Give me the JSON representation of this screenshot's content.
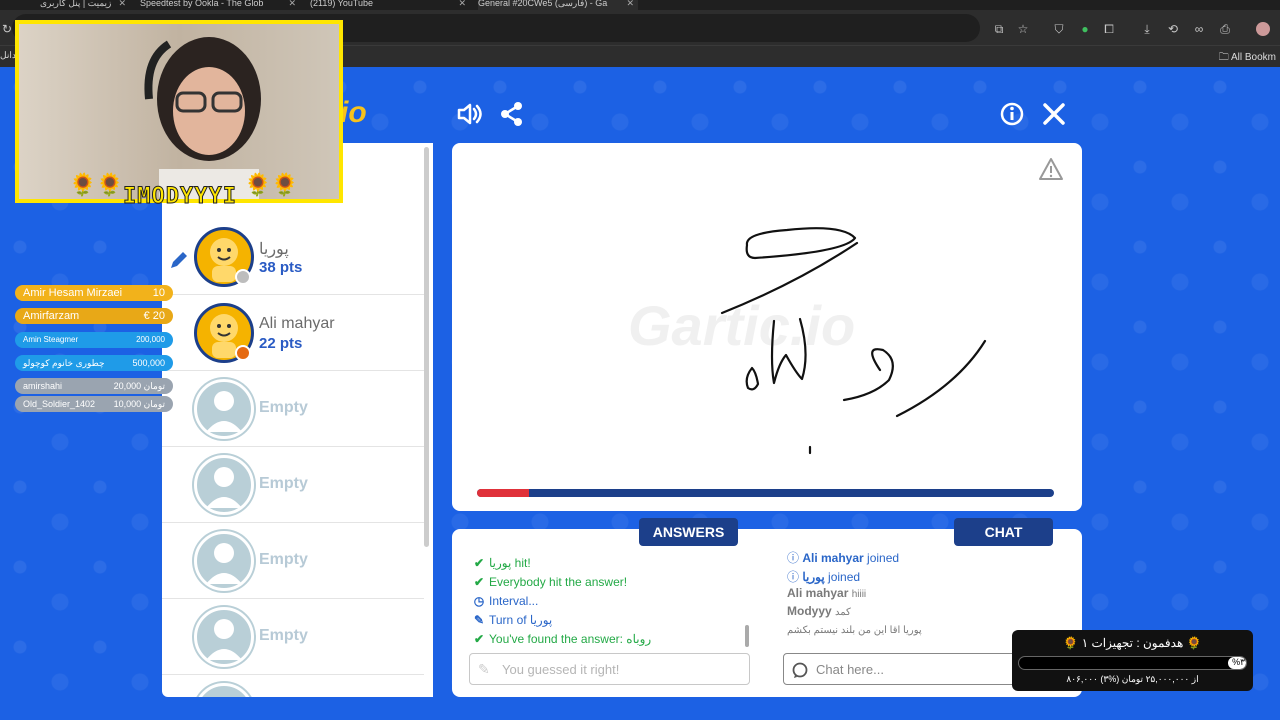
{
  "browser": {
    "tabs": [
      {
        "label": "زیمیت | پنل کاربری"
      },
      {
        "label": "Speedtest by Ookla - The Glob"
      },
      {
        "label": "(2119) YouTube"
      },
      {
        "label": "General #20CWe5 (فارسی) - Ga",
        "active": true
      }
    ],
    "bookmarks_all": "All Bookm",
    "bookmarks_left": "دانل"
  },
  "game": {
    "logo_fragment": "io",
    "canvas_watermark": "Gartic.io",
    "timer_fraction": 0.09,
    "players": [
      {
        "name": "پوریا",
        "points": "38 pts",
        "drawing": true,
        "status_color": "#bdbdbd"
      },
      {
        "name": "Ali mahyar",
        "points": "22 pts",
        "drawing": false,
        "status_color": "#e56a12"
      },
      {
        "name": "Empty"
      },
      {
        "name": "Empty"
      },
      {
        "name": "Empty"
      },
      {
        "name": "Empty"
      }
    ],
    "answers_tab": "ANSWERS",
    "chat_tab": "CHAT",
    "answers": [
      {
        "icon": "check",
        "text": "پوریا hit!",
        "color": "green"
      },
      {
        "icon": "check",
        "text": "Everybody hit the answer!",
        "color": "green"
      },
      {
        "icon": "clock",
        "text": "Interval...",
        "color": "blue"
      },
      {
        "icon": "pencil",
        "text": "Turn of پوریا",
        "color": "blue"
      },
      {
        "icon": "check",
        "text": "You've found the answer: روباه",
        "color": "green"
      }
    ],
    "answer_placeholder": "You guessed it right!",
    "chat": [
      {
        "icon": "info",
        "user": "Ali mahyar",
        "text": "joined"
      },
      {
        "icon": "info",
        "user": "پوریا",
        "text": "joined"
      },
      {
        "user": "Ali mahyar",
        "text": "hiiii"
      },
      {
        "user": "Modyyy",
        "text": "کمد"
      },
      {
        "user": "",
        "text": "پوریا اقا این من بلند نیستم بکشم"
      }
    ],
    "chat_placeholder": "Chat here..."
  },
  "stream": {
    "streamer_name": "IMODYYYI",
    "donations": [
      {
        "name": "Amir Hesam Mirzaei",
        "amount": "10",
        "color": "#f2b21b"
      },
      {
        "name": "Amirfarzam",
        "amount": "€ 20",
        "color": "#e8a817"
      },
      {
        "name": "Amin Steagmer",
        "amount": "200,000",
        "color": "#1f9be8"
      },
      {
        "name": "چطوری خانوم کوچولو",
        "amount": "500,000",
        "color": "#1f9be8"
      },
      {
        "name": "amirshahi",
        "amount": "20,000 تومان",
        "color": "#9aa4b0"
      },
      {
        "name": "Old_Soldier_1402",
        "amount": "10,000 تومان",
        "color": "#9aa4b0"
      }
    ],
    "goal": {
      "title": "هدفمون : تجهیزات ۱",
      "percent_label": "%۳",
      "progress_fraction": 0.03,
      "subtitle": "۸۰۶,۰۰۰ از ۲۵,۰۰۰,۰۰۰ تومان (%۳)"
    }
  }
}
